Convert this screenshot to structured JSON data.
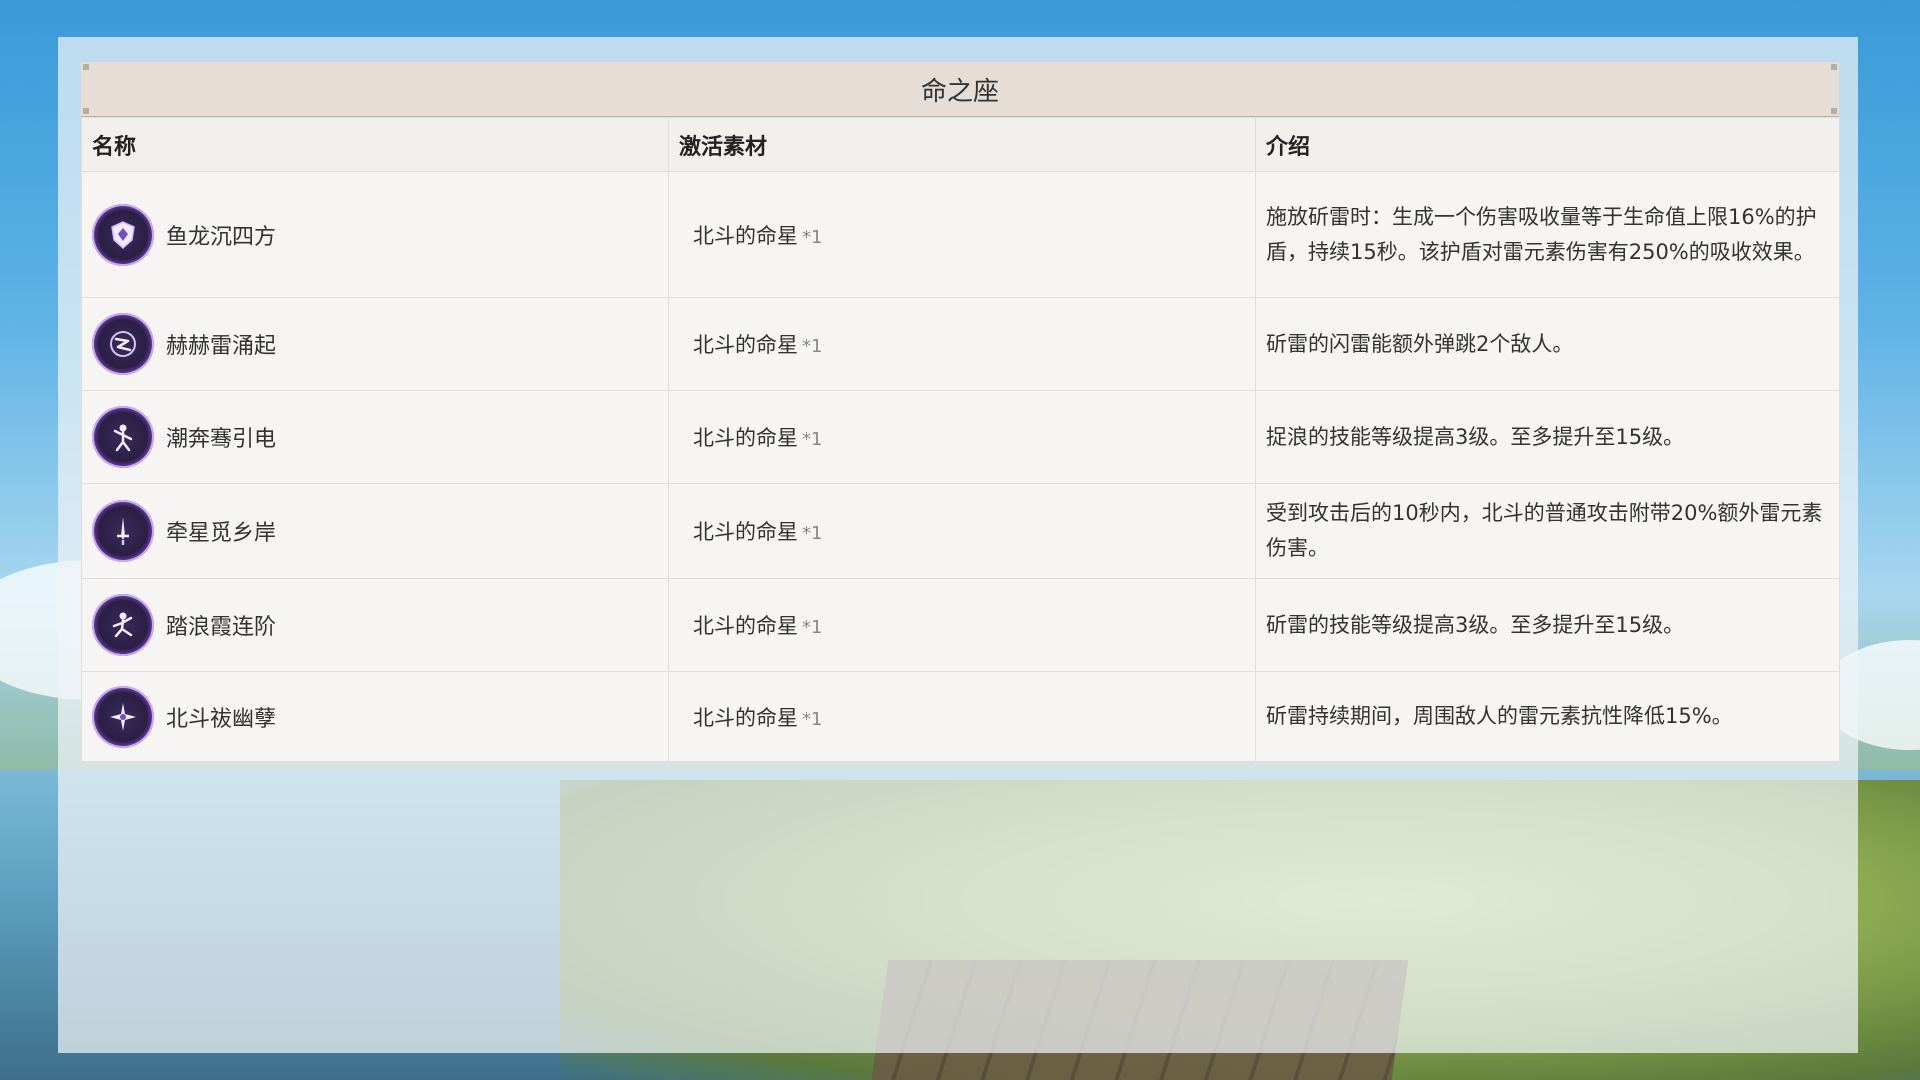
{
  "table": {
    "title": "命之座",
    "headers": [
      "名称",
      "激活素材",
      "介绍"
    ],
    "rows": [
      {
        "name": "鱼龙沉四方",
        "icon": "shield-constellation-icon",
        "material": "北斗的命星",
        "count": "*1",
        "description": "施放斫雷时：生成一个伤害吸收量等于生命值上限16%的护盾，持续15秒。该护盾对雷元素伤害有250%的吸收效果。"
      },
      {
        "name": "赫赫雷涌起",
        "icon": "lightning-bounce-constellation-icon",
        "material": "北斗的命星",
        "count": "*1",
        "description": "斫雷的闪雷能额外弹跳2个敌人。"
      },
      {
        "name": "潮奔骞引电",
        "icon": "figure-constellation-icon",
        "material": "北斗的命星",
        "count": "*1",
        "description": "捉浪的技能等级提高3级。至多提升至15级。"
      },
      {
        "name": "牵星觅乡岸",
        "icon": "sword-constellation-icon",
        "material": "北斗的命星",
        "count": "*1",
        "description": "受到攻击后的10秒内，北斗的普通攻击附带20%额外雷元素伤害。"
      },
      {
        "name": "踏浪霞连阶",
        "icon": "dancer-constellation-icon",
        "material": "北斗的命星",
        "count": "*1",
        "description": "斫雷的技能等级提高3级。至多提升至15级。"
      },
      {
        "name": "北斗祓幽孽",
        "icon": "star-burst-constellation-icon",
        "material": "北斗的命星",
        "count": "*1",
        "description": "斫雷持续期间，周围敌人的雷元素抗性降低15%。"
      }
    ]
  },
  "colors": {
    "icon_ring": "#a77ce0",
    "title_bar_bg": "#e6ddd7",
    "header_bg": "#f2f0ed",
    "row_bg": "#f6f5f3"
  }
}
